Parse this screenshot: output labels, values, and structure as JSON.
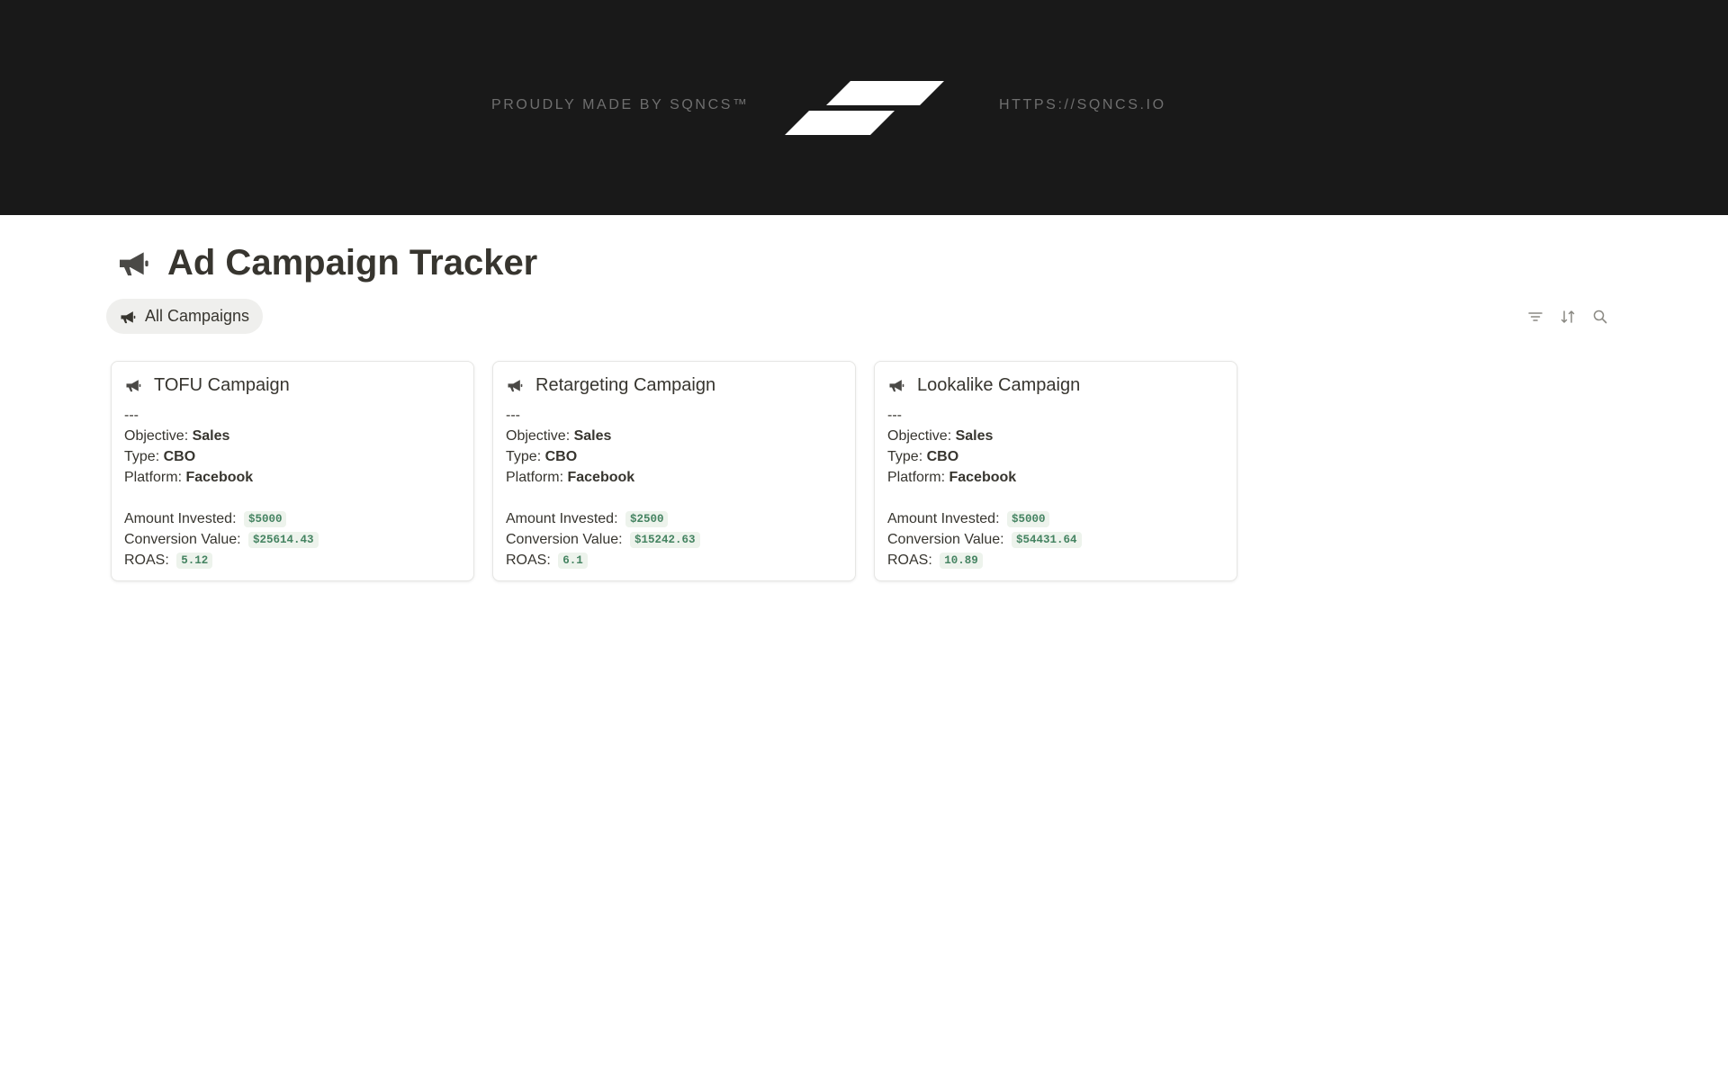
{
  "banner": {
    "left_text": "PROUDLY MADE BY SQNCS™",
    "right_text": "HTTPS://SQNCS.IO",
    "logo_icon": "sqncs-parallelogram-logo"
  },
  "page": {
    "title": "Ad Campaign Tracker",
    "title_icon": "megaphone-icon"
  },
  "views": {
    "active_tab": "All Campaigns"
  },
  "toolbar": {
    "filter_icon": "filter-icon",
    "sort_icon": "sort-icon",
    "search_icon": "search-icon"
  },
  "field_labels": {
    "separator": "---",
    "objective": "Objective:",
    "type": "Type:",
    "platform": "Platform:",
    "amount_invested": "Amount Invested:",
    "conversion_value": "Conversion Value:",
    "roas": "ROAS:"
  },
  "campaigns": [
    {
      "name": "TOFU Campaign",
      "objective": "Sales",
      "type": "CBO",
      "platform": "Facebook",
      "amount_invested": "$5000",
      "conversion_value": "$25614.43",
      "roas": "5.12"
    },
    {
      "name": "Retargeting Campaign",
      "objective": "Sales",
      "type": "CBO",
      "platform": "Facebook",
      "amount_invested": "$2500",
      "conversion_value": "$15242.63",
      "roas": "6.1"
    },
    {
      "name": "Lookalike Campaign",
      "objective": "Sales",
      "type": "CBO",
      "platform": "Facebook",
      "amount_invested": "$5000",
      "conversion_value": "$54431.64",
      "roas": "10.89"
    }
  ],
  "colors": {
    "banner_bg": "#191919",
    "banner_text": "#6f6f6f",
    "text": "#37352f",
    "code_text": "#448361",
    "code_bg": "#edf3ec",
    "tab_bg": "#efefed"
  }
}
